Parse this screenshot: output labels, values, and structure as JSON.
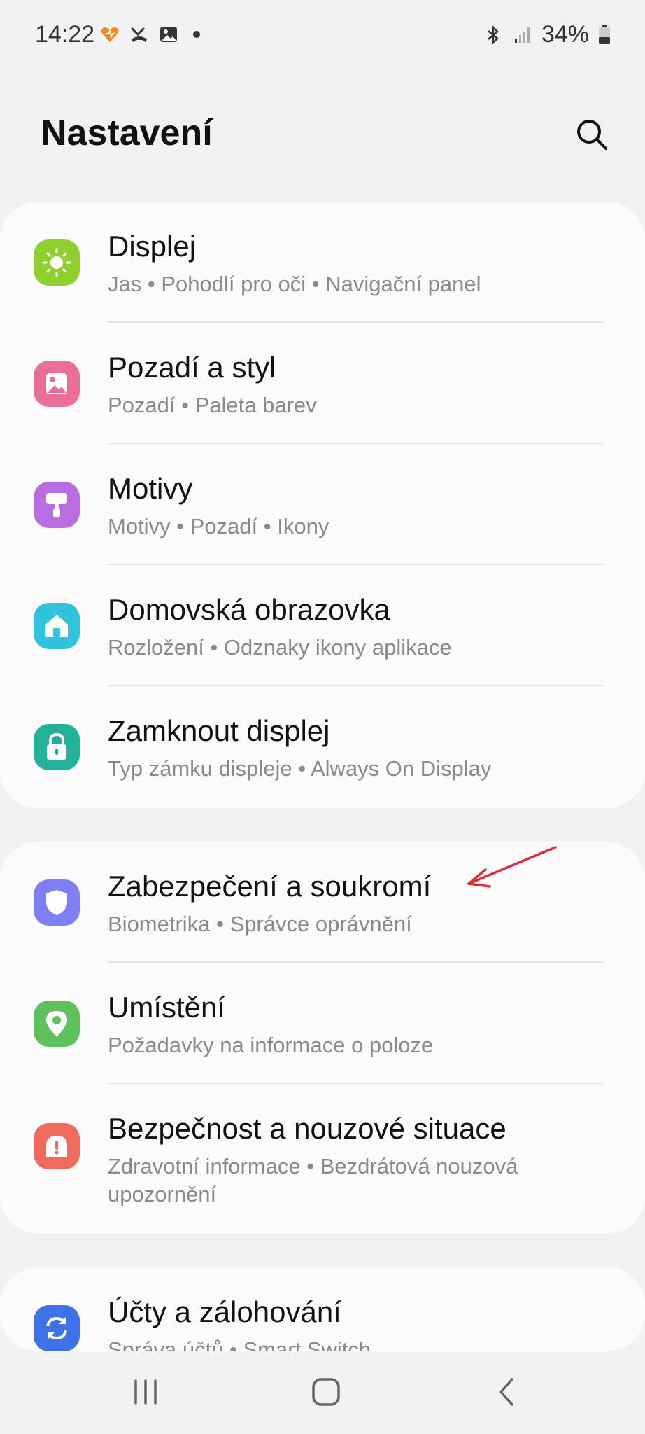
{
  "status_bar": {
    "time": "14:22",
    "battery": "34%"
  },
  "header": {
    "title": "Nastavení"
  },
  "groups": [
    {
      "items": [
        {
          "title": "Displej",
          "subtitle": "Jas  •  Pohodlí pro oči  •  Navigační panel",
          "icon": "sun-icon",
          "color": "#8fcf2e"
        },
        {
          "title": "Pozadí a styl",
          "subtitle": "Pozadí  •  Paleta barev",
          "icon": "image-icon",
          "color": "#ea6f96"
        },
        {
          "title": "Motivy",
          "subtitle": "Motivy  •  Pozadí  •  Ikony",
          "icon": "brush-icon",
          "color": "#b86ee0"
        },
        {
          "title": "Domovská obrazovka",
          "subtitle": "Rozložení  •  Odznaky ikony aplikace",
          "icon": "home-icon",
          "color": "#2fc3de"
        },
        {
          "title": "Zamknout displej",
          "subtitle": "Typ zámku displeje  •  Always On Display",
          "icon": "lock-icon",
          "color": "#21b39a"
        }
      ]
    },
    {
      "items": [
        {
          "title": "Zabezpečení a soukromí",
          "subtitle": "Biometrika  •  Správce oprávnění",
          "icon": "shield-icon",
          "color": "#7f7ff5"
        },
        {
          "title": "Umístění",
          "subtitle": "Požadavky na informace o poloze",
          "icon": "location-pin-icon",
          "color": "#5fc15b"
        },
        {
          "title": "Bezpečnost a nouzové situace",
          "subtitle": "Zdravotní informace  •  Bezdrátová nouzová upozornění",
          "icon": "alert-icon",
          "color": "#ee6b5d"
        }
      ]
    },
    {
      "items": [
        {
          "title": "Účty a zálohování",
          "subtitle": "Správa účtů  •  Smart Switch",
          "icon": "sync-icon",
          "color": "#3f72e6"
        }
      ]
    }
  ],
  "annotation": {
    "color": "#d6303c"
  }
}
